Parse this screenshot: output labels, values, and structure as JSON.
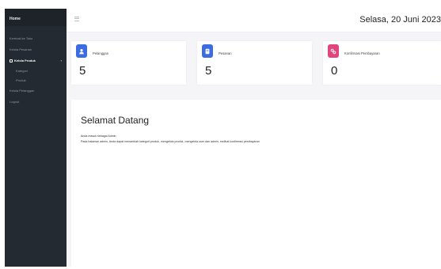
{
  "sidebar": {
    "brand": "Home",
    "items": [
      {
        "label": "Kembali ke Toko"
      },
      {
        "label": "Kelola Pesanan"
      },
      {
        "label": "Kelola Produk"
      },
      {
        "label": "Kategori"
      },
      {
        "label": "Produk"
      },
      {
        "label": "Kelola Pelanggan"
      },
      {
        "label": "Logout"
      }
    ]
  },
  "header": {
    "date": "Selasa, 20 Juni 2023"
  },
  "cards": [
    {
      "label": "Pelanggan",
      "value": "5",
      "color": "#3d6be0",
      "icon": "user-icon"
    },
    {
      "label": "Pesanan",
      "value": "5",
      "color": "#3d6be0",
      "icon": "document-icon"
    },
    {
      "label": "Konfirmasi Pembayaran",
      "value": "0",
      "color": "#e0457b",
      "icon": "link-icon"
    }
  ],
  "welcome": {
    "title": "Selamat Datang",
    "line1": "Anda masuk sebagai Admin",
    "line2": "Pada halaman admin, Anda dapat menambah kategori produk, mengelola produk, mengelola user dan admin, melihat konfirmasi pembayaran"
  }
}
